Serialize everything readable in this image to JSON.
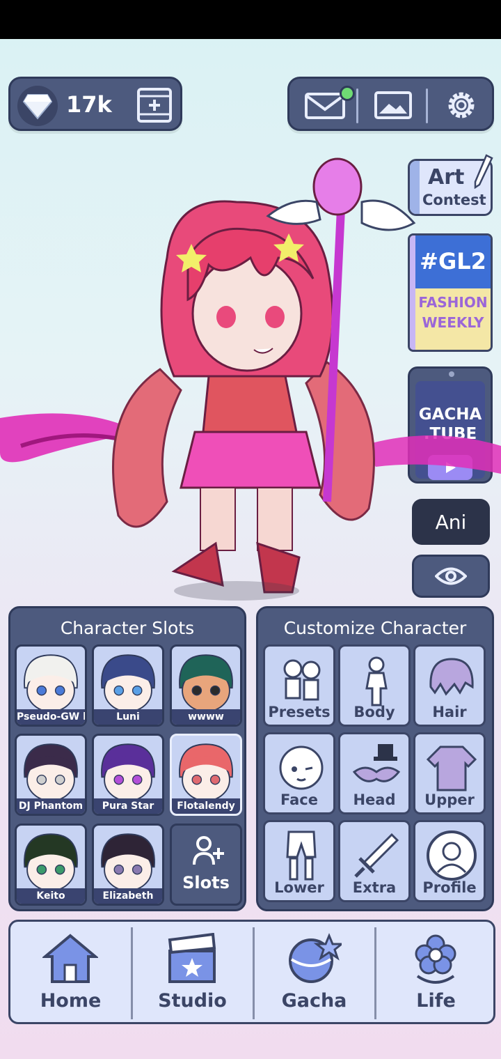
{
  "currency": {
    "amount": "17k"
  },
  "side": {
    "art_contest": {
      "line1": "Art",
      "line2": "Contest"
    },
    "gl2": {
      "title": "#GL2",
      "line1": "FASHION",
      "line2": "WEEKLY"
    },
    "gacha_tube": {
      "line1": "GACHA",
      "line2": ".TUBE"
    },
    "ani_label": "Ani"
  },
  "slots_panel": {
    "title": "Character Slots",
    "slots": [
      {
        "name": "Pseudo-GW bo",
        "hair": "#f1f1ee",
        "skin": "#fbeee8",
        "eyes": "#4b7bd8"
      },
      {
        "name": "Luni",
        "hair": "#3a4a8a",
        "skin": "#fbeee8",
        "eyes": "#5aa0e6"
      },
      {
        "name": "wwww",
        "hair": "#1f6458",
        "skin": "#e8a57c",
        "eyes": "#2b2b2b"
      },
      {
        "name": "DJ Phantom",
        "hair": "#3b2b4a",
        "skin": "#fbeee8",
        "eyes": "#cfcfcf"
      },
      {
        "name": "Pura Star",
        "hair": "#5a2f9a",
        "skin": "#fbeee8",
        "eyes": "#b34fd8"
      },
      {
        "name": "Flotalendy",
        "hair": "#e9676a",
        "skin": "#fbeee8",
        "eyes": "#e06a70"
      },
      {
        "name": "Keito",
        "hair": "#243824",
        "skin": "#fbeee8",
        "eyes": "#3c9a6b"
      },
      {
        "name": "Elizabeth",
        "hair": "#2e2436",
        "skin": "#fbeee8",
        "eyes": "#8a7ab0"
      }
    ],
    "add_label": "Slots"
  },
  "customize_panel": {
    "title": "Customize Character",
    "tiles": [
      "Presets",
      "Body",
      "Hair",
      "Face",
      "Head",
      "Upper",
      "Lower",
      "Extra",
      "Profile"
    ]
  },
  "nav": {
    "items": [
      "Home",
      "Studio",
      "Gacha",
      "Life"
    ]
  },
  "colors": {
    "panel": "#4d5a7e",
    "panel_border": "#2f3a5a",
    "tile": "#c7d3f3",
    "text_dark": "#3b4566",
    "nav_bg": "#dfe6fb"
  }
}
